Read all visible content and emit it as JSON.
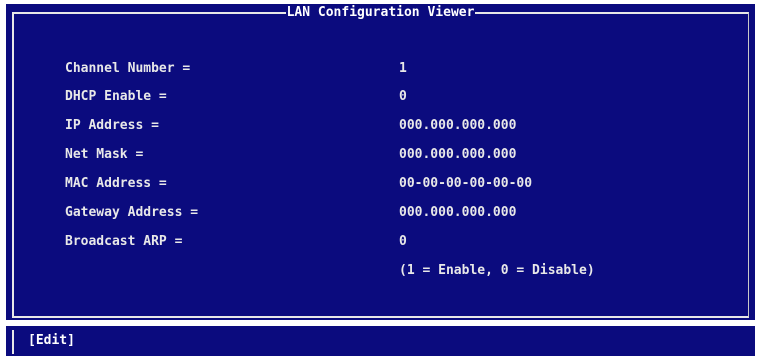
{
  "window": {
    "title": "LAN Configuration Viewer"
  },
  "fields": [
    {
      "label": "Channel Number =",
      "value": "1"
    },
    {
      "label": "DHCP Enable =",
      "value": "0"
    },
    {
      "label": "IP Address =",
      "value": "000.000.000.000"
    },
    {
      "label": "Net Mask =",
      "value": "000.000.000.000"
    },
    {
      "label": "MAC Address =",
      "value": "00-00-00-00-00-00"
    },
    {
      "label": "Gateway Address =",
      "value": "000.000.000.000"
    },
    {
      "label": "Broadcast ARP =",
      "value": "0"
    }
  ],
  "hint": "(1 = Enable, 0 = Disable)",
  "footer": {
    "edit_label": "[Edit]"
  },
  "colors": {
    "background": "#0b0b7e",
    "text": "#e8e8e8"
  }
}
